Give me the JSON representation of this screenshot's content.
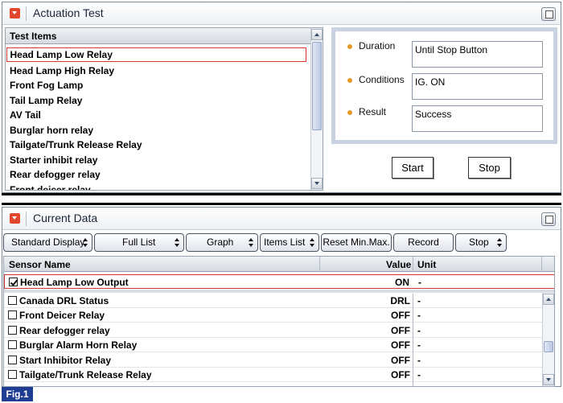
{
  "actuation": {
    "title": "Actuation Test",
    "list_header": "Test Items",
    "items": [
      "Head Lamp Low Relay",
      "Head Lamp High Relay",
      "Front Fog Lamp",
      "Tail Lamp Relay",
      "AV Tail",
      "Burglar horn relay",
      "Tailgate/Trunk Release Relay",
      "Starter inhibit relay",
      "Rear defogger relay",
      "Front deicer relay"
    ],
    "selected_index": 0,
    "details": {
      "duration_label": "Duration",
      "duration_value": "Until Stop Button",
      "conditions_label": "Conditions",
      "conditions_value": "IG. ON",
      "result_label": "Result",
      "result_value": "Success"
    },
    "start_label": "Start",
    "stop_label": "Stop"
  },
  "current_data": {
    "title": "Current Data",
    "toolbar": {
      "standard_display": "Standard Display",
      "full_list": "Full List",
      "graph": "Graph",
      "items_list": "Items List",
      "reset_min_max": "Reset Min.Max.",
      "record": "Record",
      "stop": "Stop"
    },
    "columns": {
      "sensor_name": "Sensor Name",
      "value": "Value",
      "unit": "Unit"
    },
    "selected_row": {
      "name": "Head Lamp Low Output",
      "value": "ON",
      "unit": "-",
      "checked": true
    },
    "rows": [
      {
        "name": "Canada DRL Status",
        "value": "DRL",
        "unit": "-"
      },
      {
        "name": "Front Deicer Relay",
        "value": "OFF",
        "unit": "-"
      },
      {
        "name": "Rear defogger relay",
        "value": "OFF",
        "unit": "-"
      },
      {
        "name": "Burglar Alarm Horn Relay",
        "value": "OFF",
        "unit": "-"
      },
      {
        "name": "Start Inhibitor Relay",
        "value": "OFF",
        "unit": "-"
      },
      {
        "name": "Tailgate/Trunk Release Relay",
        "value": "OFF",
        "unit": "-"
      }
    ]
  },
  "figure_label": "Fig.1"
}
